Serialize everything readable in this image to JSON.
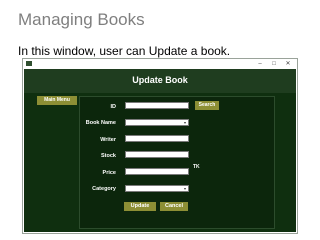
{
  "slide": {
    "title": "Managing Books",
    "subtitle": "In this window, user can Update a book."
  },
  "window": {
    "controls": [
      "–",
      "□",
      "✕"
    ],
    "form_title": "Update Book",
    "main_menu_label": "Main Menu",
    "fields": {
      "id_label": "ID",
      "book_name_label": "Book Name",
      "writer_label": "Writer",
      "stock_label": "Stock",
      "price_label": "Price",
      "category_label": "Category",
      "price_unit": "TK"
    },
    "values": {
      "id": "",
      "book_name": "",
      "writer": "",
      "stock": "",
      "price": "",
      "category": ""
    },
    "search_label": "Search",
    "update_label": "Update",
    "cancel_label": "Cancel"
  },
  "colors": {
    "window_bg": "#0f2f0f",
    "header_bg": "#1f3d1f",
    "button_bg": "#8d8f35",
    "title_gray": "#7f7f7f"
  }
}
